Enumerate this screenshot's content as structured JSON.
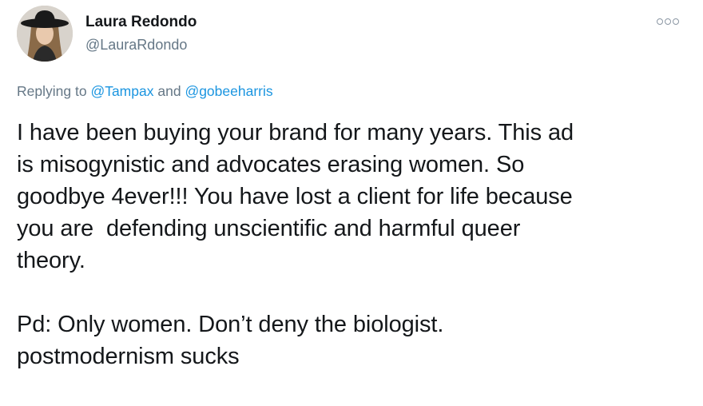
{
  "author": {
    "display_name": "Laura Redondo",
    "handle": "@LauraRdondo",
    "avatar_icon": "profile-avatar-woman-hat"
  },
  "more_icon": "more-options-icon",
  "reply": {
    "prefix": "Replying to",
    "mention_1": "@Tampax",
    "joiner": "and",
    "mention_2": "@gobeeharris"
  },
  "tweet": {
    "lines_para1": [
      "I have been buying your brand for many years. This ad",
      "is misogynistic and advocates erasing women. So",
      "goodbye 4ever!!! You have lost a client for life because",
      "you are  defending unscientific and harmful queer",
      "theory."
    ],
    "lines_para2": [
      "Pd: Only women. Don’t deny the biologist.",
      "postmodernism sucks"
    ]
  },
  "colors": {
    "link": "#1b95e0",
    "secondary_text": "#657786",
    "primary_text": "#14171a"
  }
}
